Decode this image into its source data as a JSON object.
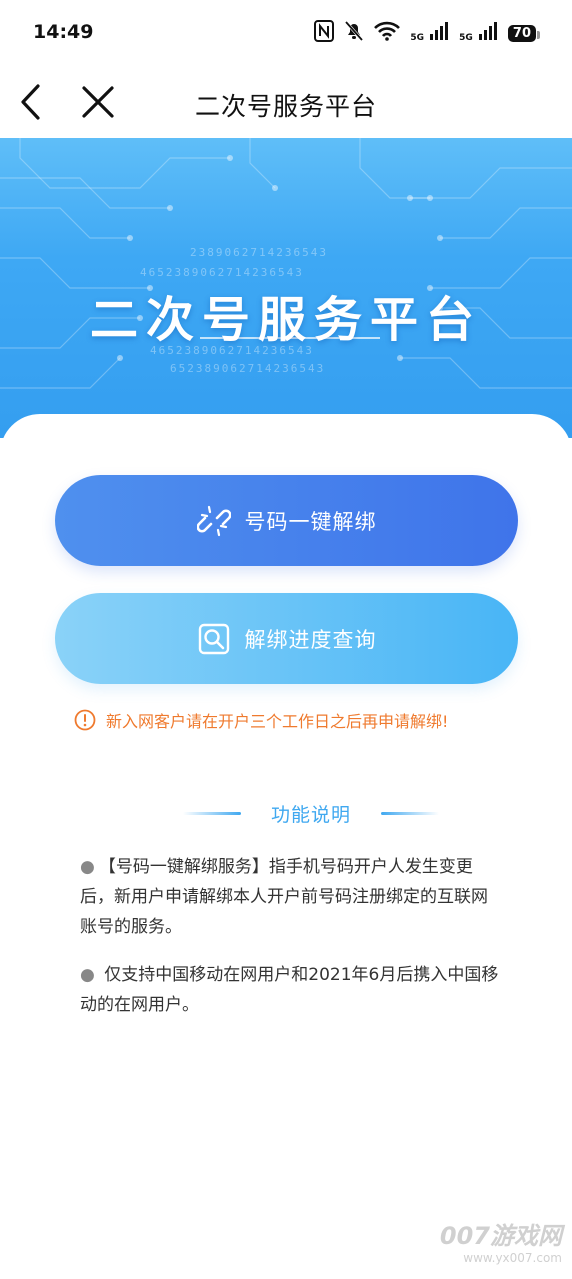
{
  "status_bar": {
    "time": "14:49",
    "network_labels": [
      "5G",
      "5G"
    ],
    "battery": "70"
  },
  "nav": {
    "title": "二次号服务平台"
  },
  "banner": {
    "title": "二次号服务平台",
    "digits": [
      "2389062714236543",
      "4652389062714236543",
      "4652389062714236543",
      "652389062714236543"
    ]
  },
  "actions": {
    "unbind_label": "号码一键解绑",
    "query_label": "解绑进度查询"
  },
  "notice": {
    "text": "新入网客户请在开户三个工作日之后再申请解绑!"
  },
  "section": {
    "title": "功能说明",
    "items": [
      "【号码一键解绑服务】指手机号码开户人发生变更后，新用户申请解绑本人开户前号码注册绑定的互联网账号的服务。",
      "仅支持中国移动在网用户和2021年6月后携入中国移动的在网用户。"
    ]
  },
  "watermark": {
    "main": "007游戏网",
    "url": "www.yx007.com"
  },
  "colors": {
    "banner_blue": "#3ea8f4",
    "button_primary": "#3f74ea",
    "button_secondary": "#48b5f6",
    "notice_orange": "#ef7a2e",
    "section_accent": "#3fa8f0"
  }
}
